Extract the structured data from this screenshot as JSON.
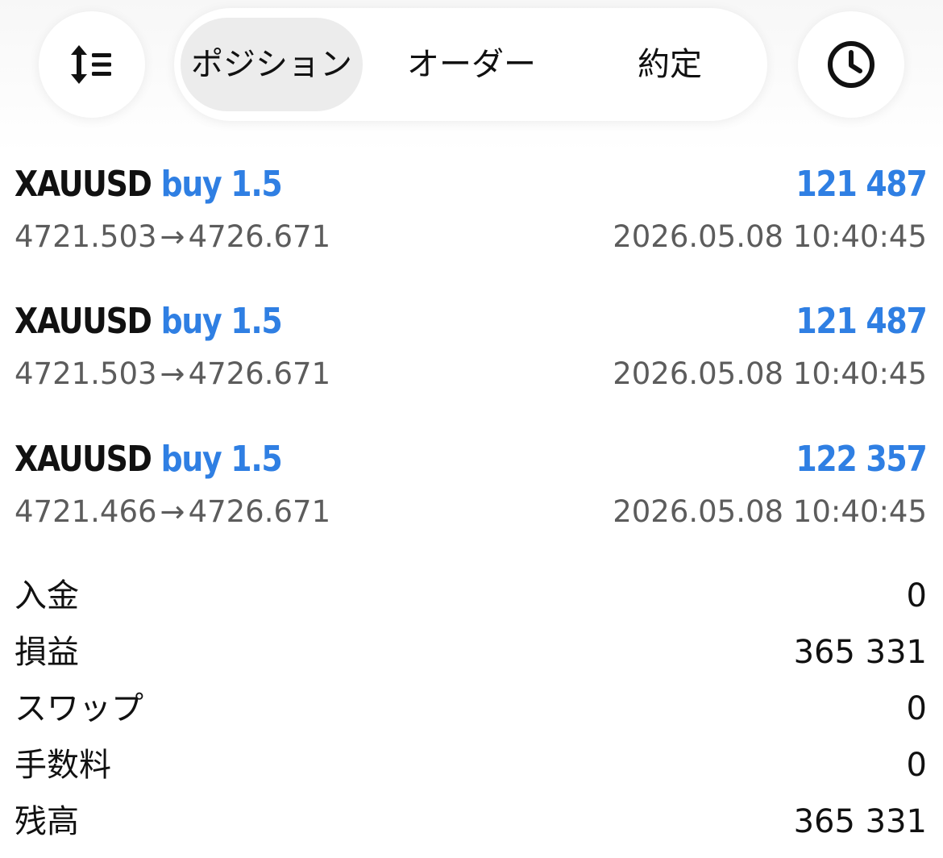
{
  "toolbar": {
    "sort_icon": "sort-list-icon",
    "history_icon": "clock-icon",
    "tabs": [
      {
        "label": "ポジション",
        "active": true
      },
      {
        "label": "オーダー",
        "active": false
      },
      {
        "label": "約定",
        "active": false
      }
    ]
  },
  "positions": [
    {
      "symbol": "XAUUSD",
      "direction": "buy",
      "volume": "1.5",
      "profit": "121 487",
      "open_price": "4721.503",
      "current_price": "4726.671",
      "time": "2026.05.08 10:40:45"
    },
    {
      "symbol": "XAUUSD",
      "direction": "buy",
      "volume": "1.5",
      "profit": "121 487",
      "open_price": "4721.503",
      "current_price": "4726.671",
      "time": "2026.05.08 10:40:45"
    },
    {
      "symbol": "XAUUSD",
      "direction": "buy",
      "volume": "1.5",
      "profit": "122 357",
      "open_price": "4721.466",
      "current_price": "4726.671",
      "time": "2026.05.08 10:40:45"
    }
  ],
  "arrow": "→",
  "summary": [
    {
      "label": "入金",
      "value": "0"
    },
    {
      "label": "損益",
      "value": "365 331"
    },
    {
      "label": "スワップ",
      "value": "0"
    },
    {
      "label": "手数料",
      "value": "0"
    },
    {
      "label": "残高",
      "value": "365 331"
    }
  ],
  "colors": {
    "accent_blue": "#2f7fe3",
    "text_primary": "#111111",
    "text_secondary": "#5c5c5c",
    "tab_active_bg": "#ececec"
  }
}
